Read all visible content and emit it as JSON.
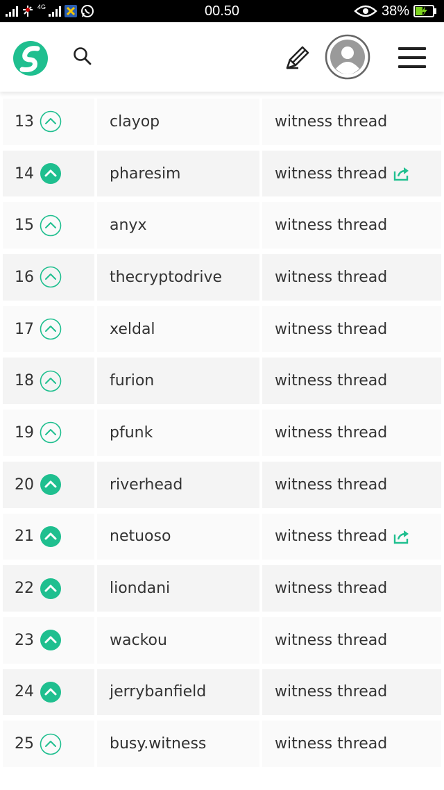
{
  "status_bar": {
    "network": "4G",
    "time": "00.50",
    "battery": "38%"
  },
  "header": {
    "logo_icon": "steemit-logo-icon",
    "search_icon": "search-icon",
    "write_icon": "pencil-icon",
    "avatar_icon": "user-avatar-icon",
    "menu_icon": "hamburger-menu-icon"
  },
  "colors": {
    "accent": "#1fbf8f",
    "text": "#333333",
    "row_shade": "#f4f4f4",
    "row_plain": "#fafafa"
  },
  "witnesses": [
    {
      "rank": "13",
      "name": "clayop",
      "thread": "witness thread",
      "voted": false,
      "external": false
    },
    {
      "rank": "14",
      "name": "pharesim",
      "thread": "witness thread",
      "voted": true,
      "external": true
    },
    {
      "rank": "15",
      "name": "anyx",
      "thread": "witness thread",
      "voted": false,
      "external": false
    },
    {
      "rank": "16",
      "name": "thecryptodrive",
      "thread": "witness thread",
      "voted": false,
      "external": false
    },
    {
      "rank": "17",
      "name": "xeldal",
      "thread": "witness thread",
      "voted": false,
      "external": false
    },
    {
      "rank": "18",
      "name": "furion",
      "thread": "witness thread",
      "voted": false,
      "external": false
    },
    {
      "rank": "19",
      "name": "pfunk",
      "thread": "witness thread",
      "voted": false,
      "external": false
    },
    {
      "rank": "20",
      "name": "riverhead",
      "thread": "witness thread",
      "voted": true,
      "external": false
    },
    {
      "rank": "21",
      "name": "netuoso",
      "thread": "witness thread",
      "voted": true,
      "external": true
    },
    {
      "rank": "22",
      "name": "liondani",
      "thread": "witness thread",
      "voted": true,
      "external": false
    },
    {
      "rank": "23",
      "name": "wackou",
      "thread": "witness thread",
      "voted": true,
      "external": false
    },
    {
      "rank": "24",
      "name": "jerrybanfield",
      "thread": "witness thread",
      "voted": true,
      "external": false
    },
    {
      "rank": "25",
      "name": "busy.witness",
      "thread": "witness thread",
      "voted": false,
      "external": false
    }
  ]
}
